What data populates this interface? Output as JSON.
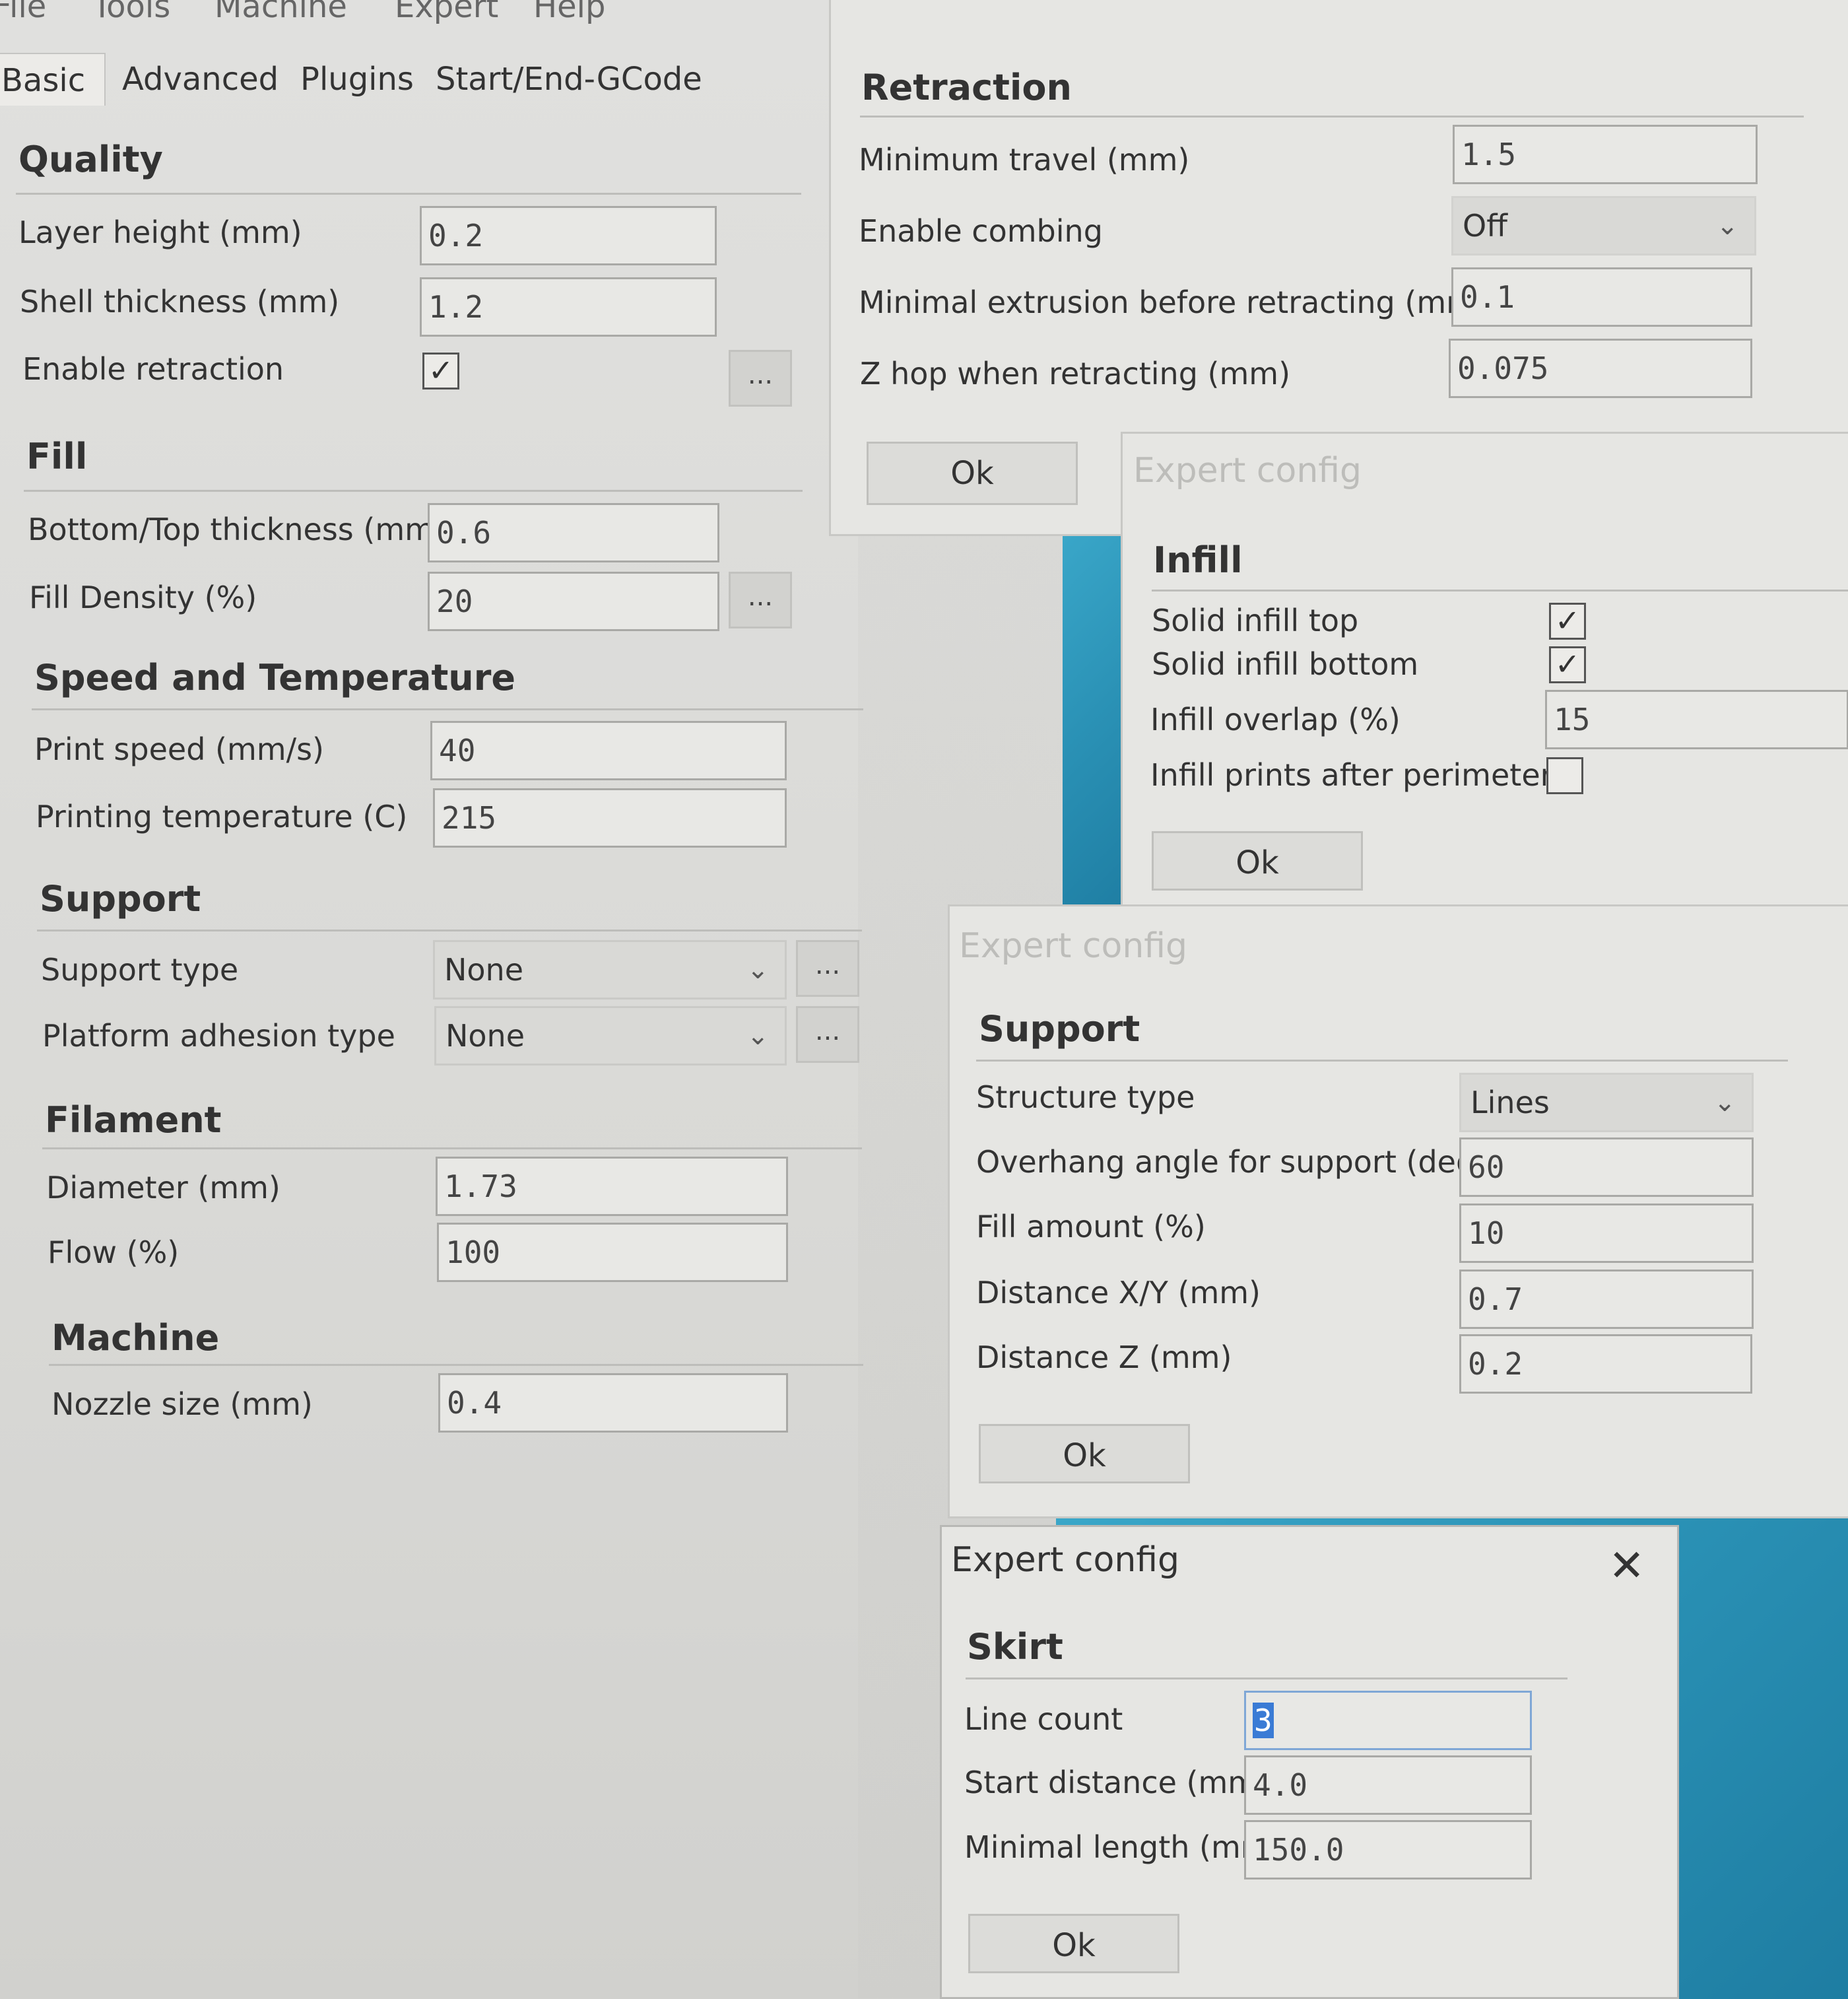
{
  "menu": [
    "File",
    "Tools",
    "Machine",
    "Expert",
    "Help"
  ],
  "tabs": [
    "Basic",
    "Advanced",
    "Plugins",
    "Start/End-GCode"
  ],
  "main": {
    "quality": {
      "title": "Quality",
      "layer_height_label": "Layer height (mm)",
      "layer_height": "0.2",
      "shell_label": "Shell thickness (mm)",
      "shell": "1.2",
      "retraction_label": "Enable retraction",
      "retraction_checked": "✓"
    },
    "fill": {
      "title": "Fill",
      "bt_label": "Bottom/Top thickness (mm)",
      "bt": "0.6",
      "density_label": "Fill Density (%)",
      "density": "20"
    },
    "speed": {
      "title": "Speed and Temperature",
      "speed_label": "Print speed (mm/s)",
      "speed": "40",
      "temp_label": "Printing temperature (C)",
      "temp": "215"
    },
    "support": {
      "title": "Support",
      "type_label": "Support type",
      "type": "None",
      "adhesion_label": "Platform adhesion type",
      "adhesion": "None"
    },
    "filament": {
      "title": "Filament",
      "diameter_label": "Diameter (mm)",
      "diameter": "1.73",
      "flow_label": "Flow (%)",
      "flow": "100"
    },
    "machine": {
      "title": "Machine",
      "nozzle_label": "Nozzle size (mm)",
      "nozzle": "0.4"
    },
    "dots": "..."
  },
  "retraction_dialog": {
    "title": "Retraction",
    "min_travel_label": "Minimum travel (mm)",
    "min_travel": "1.5",
    "combing_label": "Enable combing",
    "combing": "Off",
    "min_extrusion_label": "Minimal extrusion before retracting (mm)",
    "min_extrusion": "0.1",
    "zhop_label": "Z hop when retracting (mm)",
    "zhop": "0.075",
    "ok": "Ok"
  },
  "infill_dialog": {
    "window_title": "Expert config",
    "title": "Infill",
    "solid_top_label": "Solid infill top",
    "solid_top": "✓",
    "solid_bottom_label": "Solid infill bottom",
    "solid_bottom": "✓",
    "overlap_label": "Infill overlap (%)",
    "overlap": "15",
    "after_perim_label": "Infill prints after perimeters",
    "ok": "Ok"
  },
  "support_dialog": {
    "window_title": "Expert config",
    "title": "Support",
    "structure_label": "Structure type",
    "structure": "Lines",
    "overhang_label": "Overhang angle for support (deg)",
    "overhang": "60",
    "fill_label": "Fill amount (%)",
    "fill": "10",
    "dxy_label": "Distance X/Y (mm)",
    "dxy": "0.7",
    "dz_label": "Distance Z (mm)",
    "dz": "0.2",
    "ok": "Ok"
  },
  "skirt_dialog": {
    "window_title": "Expert config",
    "close": "✕",
    "title": "Skirt",
    "line_count_label": "Line count",
    "line_count": "3",
    "start_label": "Start distance (mm)",
    "start": "4.0",
    "minlen_label": "Minimal length (mm)",
    "minlen": "150.0",
    "ok": "Ok"
  },
  "chevron": "⌄"
}
